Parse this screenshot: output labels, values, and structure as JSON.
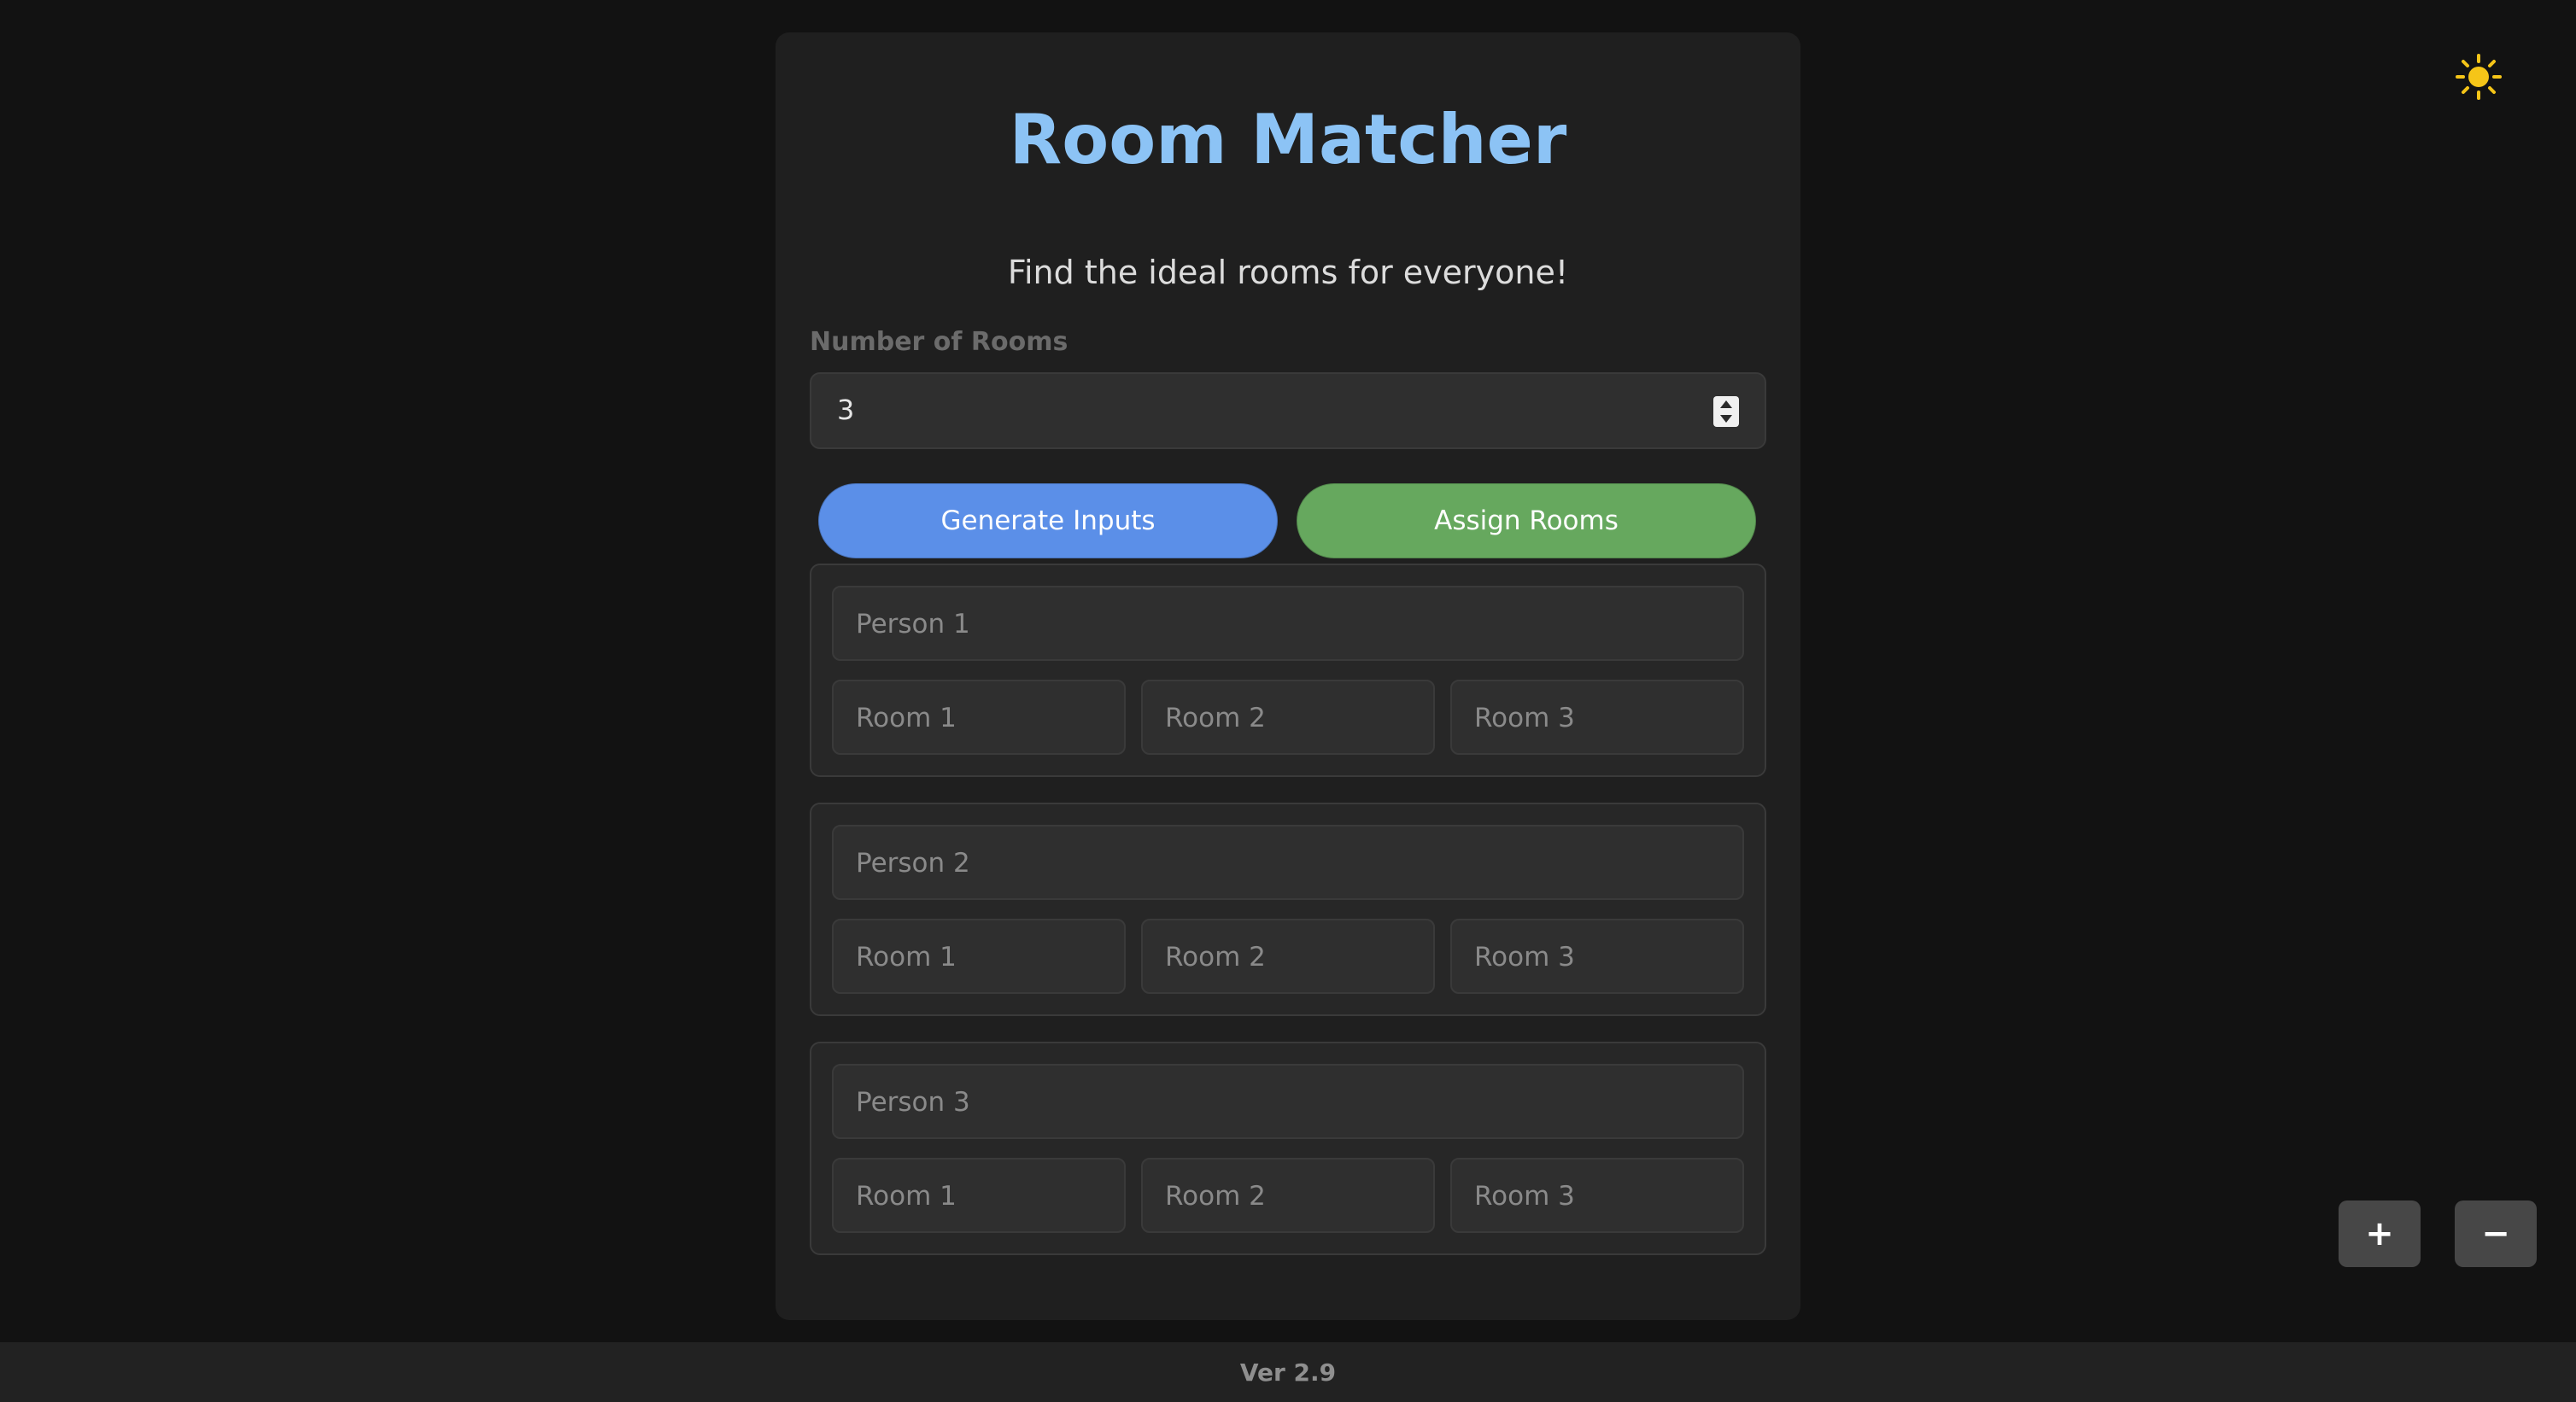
{
  "app": {
    "title": "Room Matcher",
    "subtitle": "Find the ideal rooms for everyone!"
  },
  "room_count": {
    "label": "Number of Rooms",
    "value": "3"
  },
  "actions": {
    "generate_label": "Generate Inputs",
    "assign_label": "Assign Rooms"
  },
  "people": [
    {
      "name_placeholder": "Person 1",
      "room_placeholders": [
        "Room 1",
        "Room 2",
        "Room 3"
      ]
    },
    {
      "name_placeholder": "Person 2",
      "room_placeholders": [
        "Room 1",
        "Room 2",
        "Room 3"
      ]
    },
    {
      "name_placeholder": "Person 3",
      "room_placeholders": [
        "Room 1",
        "Room 2",
        "Room 3"
      ]
    }
  ],
  "controls": {
    "theme_icon": "sun-icon",
    "zoom_in_label": "+",
    "zoom_out_label": "−"
  },
  "footer": {
    "version": "Ver 2.9"
  },
  "colors": {
    "background": "#121212",
    "card": "#1f1f1f",
    "title": "#8cc3f5",
    "generate_button": "#5b8fe8",
    "assign_button": "#66a85e",
    "sun": "#f5c518"
  }
}
